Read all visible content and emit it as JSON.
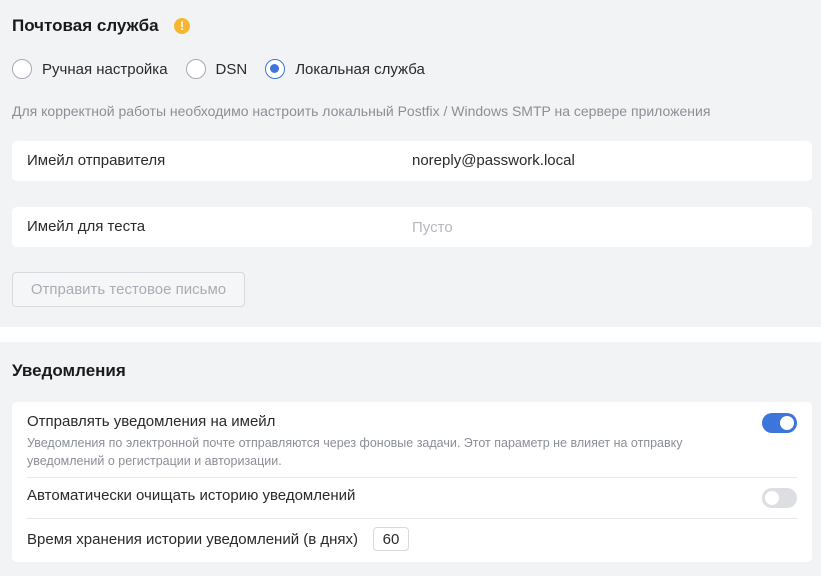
{
  "mail": {
    "title": "Почтовая служба",
    "warning_icon": "warning-icon",
    "options": [
      {
        "label": "Ручная настройка",
        "checked": false
      },
      {
        "label": "DSN",
        "checked": false
      },
      {
        "label": "Локальная служба",
        "checked": true
      }
    ],
    "hint": "Для корректной работы необходимо настроить локальный Postfix / Windows SMTP на сервере приложения",
    "sender_label": "Имейл отправителя",
    "sender_value": "noreply@passwork.local",
    "test_label": "Имейл для теста",
    "test_placeholder": "Пусто",
    "test_value": "",
    "send_button_label": "Отправить тестовое письмо"
  },
  "notifications": {
    "title": "Уведомления",
    "email_toggle_label": "Отправлять уведомления на имейл",
    "email_toggle_desc": "Уведомления по электронной почте отправляются через фоновые задачи. Этот параметр не влияет на отправку уведомлений о регистрации и авторизации.",
    "email_toggle_on": true,
    "autoclean_label": "Автоматически очищать историю уведомлений",
    "autoclean_on": false,
    "retention_label": "Время хранения истории уведомлений (в днях)",
    "retention_days": "60"
  },
  "colors": {
    "accent": "#3d75db",
    "warning": "#f5b731",
    "section_bg": "#f2f3f5"
  }
}
